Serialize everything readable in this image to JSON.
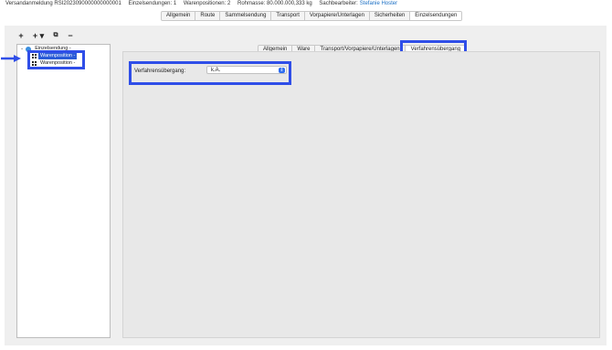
{
  "header": {
    "document": "Versandanmeldung RSI2023090000000000001",
    "einzelsendungen": "Einzelsendungen: 1",
    "warenpositionen": "Warenpositionen: 2",
    "rohmasse": "Rohmasse: 80.000.000,333 kg",
    "sachbearbeiter_label": "Sachbearbeiter:",
    "sachbearbeiter_name": "Stefanie Hoster"
  },
  "main_tabs": [
    "Allgemein",
    "Route",
    "Sammelsendung",
    "Transport",
    "Vorpapiere/Unterlagen",
    "Sicherheiten",
    "Einzelsendungen"
  ],
  "main_tabs_active": 6,
  "toolbar": {
    "add": "+",
    "add_menu": "+ ▾",
    "copy": "⧉",
    "remove": "−"
  },
  "tree": {
    "root": "Einzelsendung -",
    "items": [
      "Warenposition -",
      "Warenposition -"
    ]
  },
  "sub_tabs": [
    "Allgemein",
    "Ware",
    "Transport/Vorpapiere/Unterlagen",
    "Verfahrensübergang"
  ],
  "sub_tabs_active": 3,
  "form": {
    "label": "Verfahrensübergang:",
    "value": "k.A.",
    "toggle": "⇕"
  },
  "colors": {
    "highlight": "#2f4ee8",
    "selection": "#2a5bd7",
    "link": "#1a6fc4"
  }
}
